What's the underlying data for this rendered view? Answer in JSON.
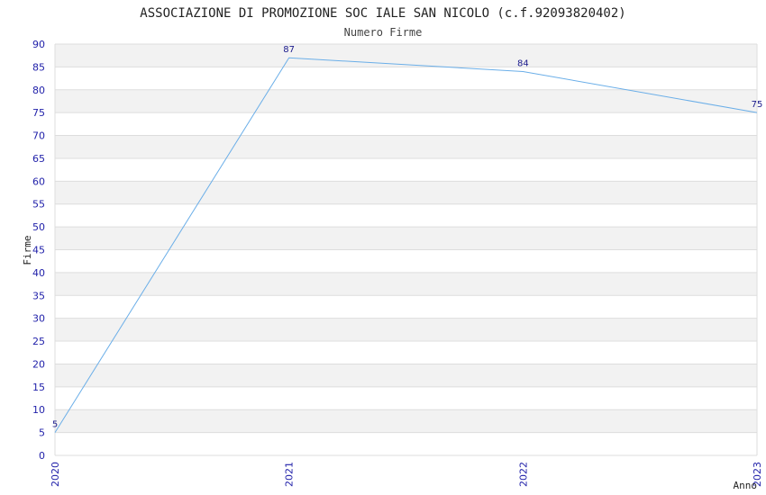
{
  "chart_data": {
    "type": "line",
    "title": "ASSOCIAZIONE DI PROMOZIONE SOC IALE SAN NICOLO (c.f.92093820402)",
    "subtitle": "Numero Firme",
    "xlabel": "Anno",
    "ylabel": "Firme",
    "categories": [
      "2020",
      "2021",
      "2022",
      "2023"
    ],
    "series": [
      {
        "values": [
          5,
          87,
          84,
          75
        ]
      }
    ],
    "ylim": [
      0,
      90
    ],
    "ytick_step": 5,
    "grid": "horizontal bands",
    "colors": {
      "line": "#6aaee8",
      "tick_text": "#2222aa",
      "data_label": "#1a1a8c",
      "band": "#f2f2f2",
      "grid": "#dddddd"
    }
  }
}
